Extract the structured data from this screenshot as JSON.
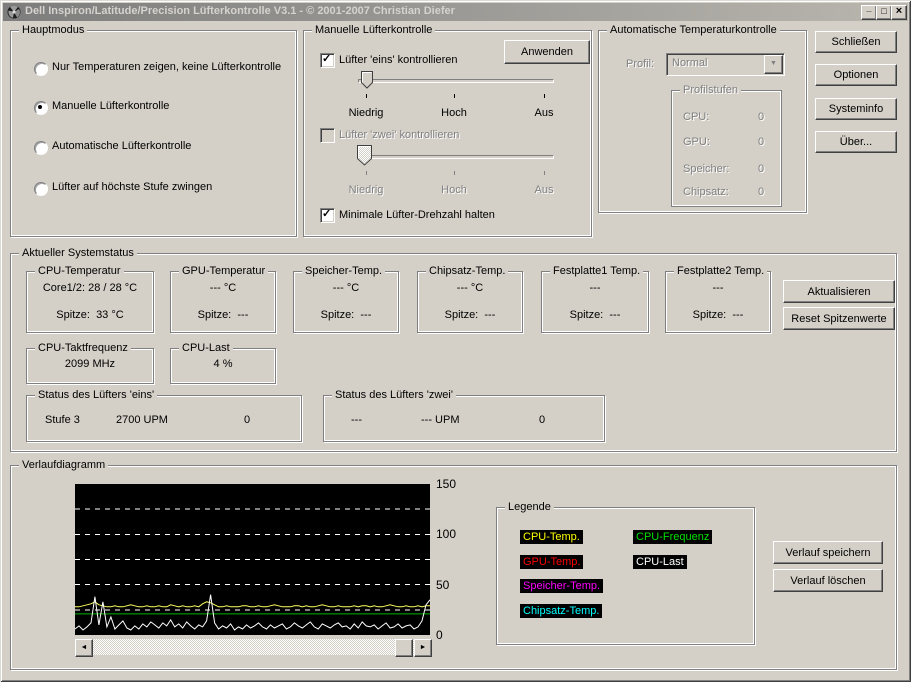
{
  "window": {
    "title": "Dell Inspiron/Latitude/Precision Lüfterkontrolle V3.1 - © 2001-2007 Christian Diefer",
    "minimize_glyph": "_",
    "maximize_glyph": "□",
    "close_glyph": "×"
  },
  "hauptmodus": {
    "title": "Hauptmodus",
    "options": [
      {
        "label": "Nur Temperaturen zeigen, keine Lüfterkontrolle",
        "selected": false
      },
      {
        "label": "Manuelle Lüfterkontrolle",
        "selected": true
      },
      {
        "label": "Automatische Lüfterkontrolle",
        "selected": false
      },
      {
        "label": "Lüfter auf höchste Stufe zwingen",
        "selected": false
      }
    ]
  },
  "manuelle": {
    "title": "Manuelle Lüfterkontrolle",
    "apply_button": "Anwenden",
    "fan1": {
      "label": "Lüfter 'eins' kontrollieren",
      "checked": true
    },
    "fan2": {
      "label": "Lüfter 'zwei' kontrollieren",
      "checked": false
    },
    "slider_labels": [
      "Niedrig",
      "Hoch",
      "Aus"
    ],
    "min_rpm": {
      "label": "Minimale Lüfter-Drehzahl halten",
      "checked": true
    }
  },
  "auto": {
    "title": "Automatische Temperaturkontrolle",
    "profil_label": "Profil:",
    "profil_value": "Normal",
    "dropdown_arrow": "▼",
    "stufen": {
      "title": "Profilstufen",
      "rows": [
        {
          "label": "CPU:",
          "value": "0"
        },
        {
          "label": "GPU:",
          "value": "0"
        },
        {
          "label": "Speicher:",
          "value": "0"
        },
        {
          "label": "Chipsatz:",
          "value": "0"
        }
      ]
    }
  },
  "actions": [
    "Schließen",
    "Optionen",
    "Systeminfo",
    "Über..."
  ],
  "status": {
    "title": "Aktueller Systemstatus",
    "boxes": [
      {
        "title": "CPU-Temperatur",
        "value": "Core1/2: 28 / 28 °C",
        "peak_label": "Spitze:",
        "peak_value": "33 °C"
      },
      {
        "title": "GPU-Temperatur",
        "value": "--- °C",
        "peak_label": "Spitze:",
        "peak_value": "---"
      },
      {
        "title": "Speicher-Temp.",
        "value": "--- °C",
        "peak_label": "Spitze:",
        "peak_value": "---"
      },
      {
        "title": "Chipsatz-Temp.",
        "value": "--- °C",
        "peak_label": "Spitze:",
        "peak_value": "---"
      },
      {
        "title": "Festplatte1 Temp.",
        "value": "---",
        "peak_label": "Spitze:",
        "peak_value": "---"
      },
      {
        "title": "Festplatte2 Temp.",
        "value": "---",
        "peak_label": "Spitze:",
        "peak_value": "---"
      }
    ],
    "refresh_button": "Aktualisieren",
    "reset_button": "Reset Spitzenwerte",
    "freq": {
      "title": "CPU-Taktfrequenz",
      "value": "2099 MHz"
    },
    "load": {
      "title": "CPU-Last",
      "value": "4 %"
    },
    "fan1": {
      "title": "Status des Lüfters 'eins'",
      "stage": "Stufe 3",
      "rpm": "2700 UPM",
      "count": "0"
    },
    "fan2": {
      "title": "Status des Lüfters 'zwei'",
      "stage": "---",
      "rpm": "--- UPM",
      "count": "0"
    }
  },
  "verlauf": {
    "title": "Verlaufdiagramm",
    "legend": {
      "title": "Legende",
      "items": [
        {
          "label": "CPU-Temp.",
          "color": "#ffff00"
        },
        {
          "label": "CPU-Frequenz",
          "color": "#00e100"
        },
        {
          "label": "GPU-Temp.",
          "color": "#ff0000"
        },
        {
          "label": "CPU-Last",
          "color": "#ffffff"
        },
        {
          "label": "Speicher-Temp.",
          "color": "#ff00ff"
        },
        {
          "label": "Chipsatz-Temp.",
          "color": "#00ffff"
        }
      ]
    },
    "save_button": "Verlauf speichern",
    "clear_button": "Verlauf löschen",
    "scroll_left": "◄",
    "scroll_right": "►"
  },
  "chart_data": {
    "type": "line",
    "ylim": [
      0,
      150
    ],
    "yticks": [
      0,
      50,
      100,
      150
    ],
    "gridlines": [
      25,
      50,
      75,
      100,
      125
    ],
    "series": [
      {
        "name": "CPU-Frequenz",
        "color": "#00b400",
        "values": [
          21,
          21
        ]
      },
      {
        "name": "CPU-Temp.",
        "color": "#ffff60",
        "values": [
          28,
          28,
          29,
          30,
          31,
          33,
          30,
          29,
          28,
          28,
          29,
          28,
          28,
          29,
          30,
          29,
          28,
          28,
          29,
          28,
          28,
          29,
          28,
          28,
          30,
          29,
          28,
          29,
          28,
          28,
          29,
          28,
          31,
          33,
          32,
          30,
          28,
          28,
          29,
          28,
          28,
          28,
          29,
          29,
          28,
          28,
          29,
          28,
          28,
          29,
          30,
          29,
          28,
          28,
          28,
          29,
          29,
          28,
          29,
          28,
          28,
          29,
          30,
          29,
          28,
          28,
          29,
          28,
          28,
          28,
          29,
          28,
          29,
          29,
          28,
          29,
          28,
          28,
          29,
          30,
          29,
          28,
          28,
          29,
          28,
          28,
          29,
          28,
          29,
          29
        ]
      },
      {
        "name": "CPU-Last",
        "color": "#ffffff",
        "values": [
          6,
          9,
          5,
          8,
          12,
          38,
          10,
          33,
          8,
          18,
          6,
          10,
          14,
          7,
          5,
          9,
          6,
          11,
          8,
          13,
          10,
          7,
          12,
          9,
          15,
          8,
          11,
          7,
          13,
          9,
          6,
          10,
          8,
          14,
          40,
          12,
          6,
          9,
          7,
          11,
          5,
          8,
          6,
          10,
          7,
          9,
          12,
          8,
          6,
          10,
          7,
          9,
          11,
          6,
          8,
          12,
          9,
          7,
          10,
          13,
          8,
          6,
          11,
          9,
          7,
          10,
          12,
          8,
          9,
          6,
          11,
          7,
          13,
          9,
          8,
          10,
          6,
          9,
          12,
          7,
          8,
          11,
          7,
          9,
          10,
          6,
          8,
          14,
          30,
          35
        ]
      }
    ]
  }
}
